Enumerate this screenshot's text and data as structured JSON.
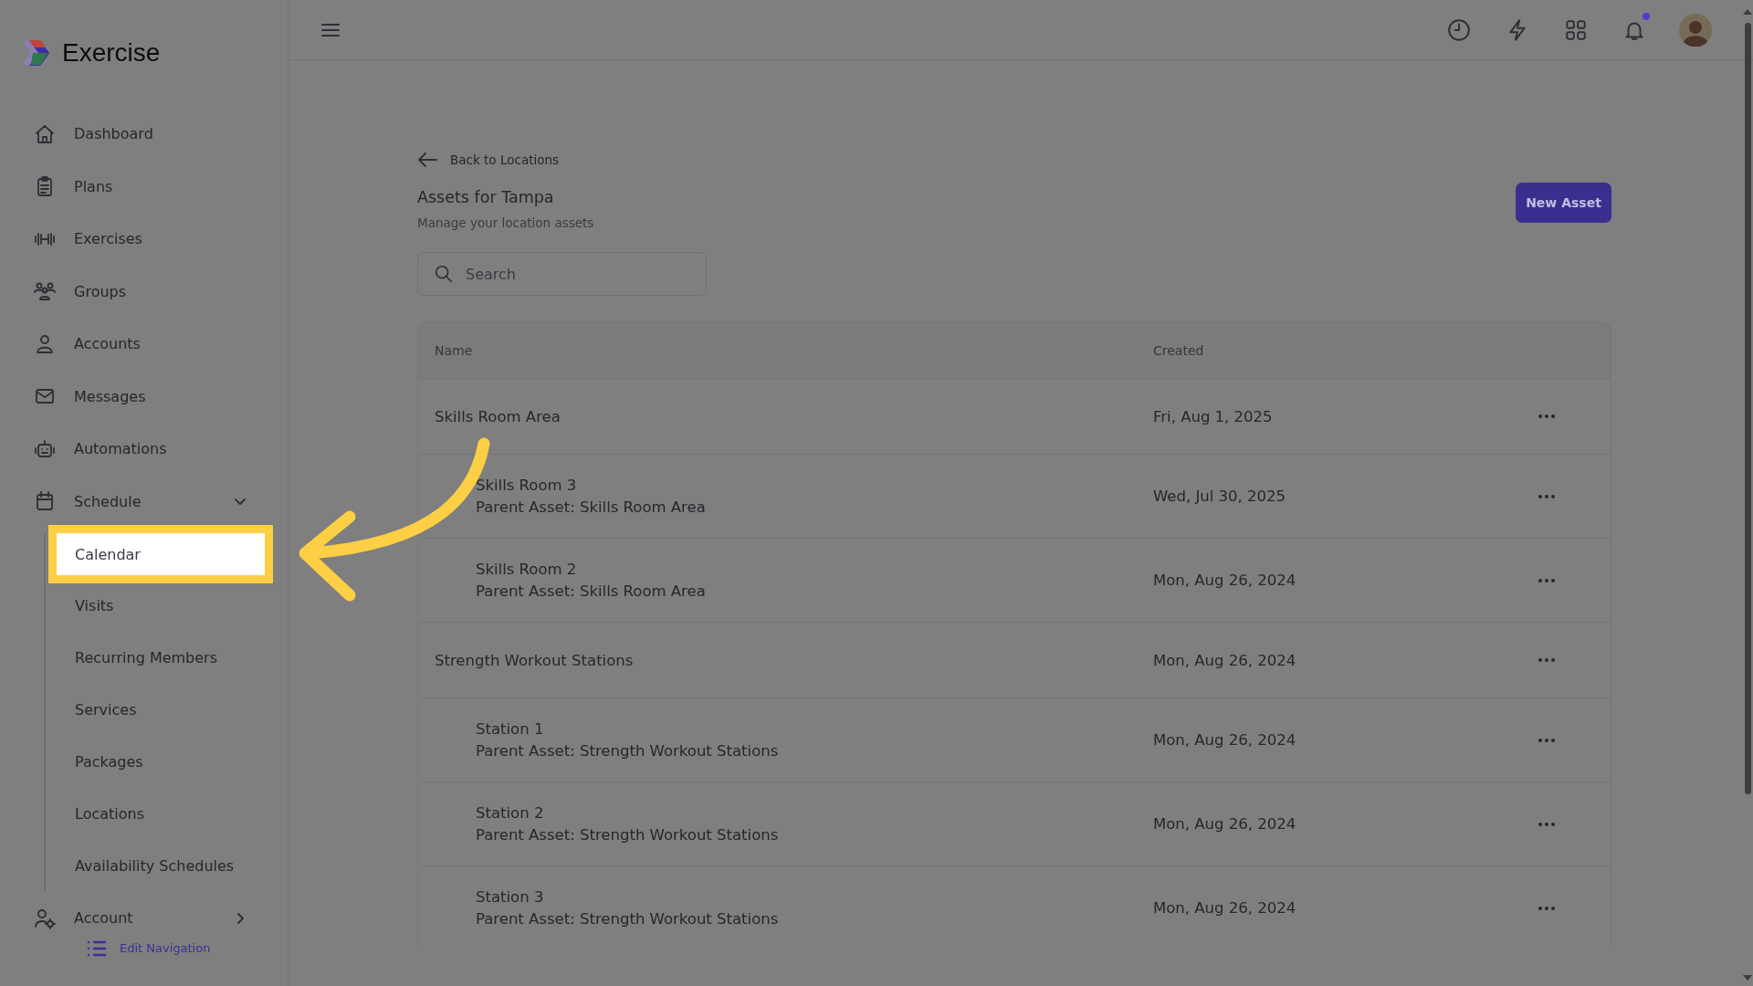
{
  "sidebar": {
    "logo": "Exercise",
    "items": [
      {
        "label": "Dashboard"
      },
      {
        "label": "Plans"
      },
      {
        "label": "Exercises"
      },
      {
        "label": "Groups"
      },
      {
        "label": "Accounts"
      },
      {
        "label": "Messages"
      },
      {
        "label": "Automations"
      },
      {
        "label": "Schedule",
        "expanded": true,
        "children": [
          {
            "label": "Calendar",
            "selected": true
          },
          {
            "label": "Visits",
            "selected": false
          },
          {
            "label": "Recurring Members",
            "selected": false
          },
          {
            "label": "Services",
            "selected": false
          },
          {
            "label": "Packages",
            "selected": false
          },
          {
            "label": "Locations",
            "selected": false
          },
          {
            "label": "Availability Schedules",
            "selected": false
          }
        ]
      },
      {
        "label": "Account",
        "expanded": false
      }
    ],
    "edit_link": "Edit Navigation"
  },
  "topbar": {
    "notifications_unread": true
  },
  "page": {
    "back_link": "Back to Locations",
    "title": "Assets for Tampa",
    "subtitle": "Manage your location assets",
    "new_button": "New Asset",
    "search": {
      "placeholder": "Search"
    },
    "table": {
      "columns": [
        "Name",
        "Created"
      ],
      "rows": [
        {
          "name": "Skills Room Area",
          "created": "Fri, Aug 1, 2025",
          "children": [
            {
              "name": "Skills Room 3",
              "parent": "Parent Asset: Skills Room Area",
              "created": "Wed, Jul 30, 2025"
            },
            {
              "name": "Skills Room 2",
              "parent": "Parent Asset: Skills Room Area",
              "created": "Mon, Aug 26, 2024"
            }
          ]
        },
        {
          "name": "Strength Workout Stations",
          "created": "Mon, Aug 26, 2024",
          "children": [
            {
              "name": "Station 1",
              "parent": "Parent Asset: Strength Workout Stations",
              "created": "Mon, Aug 26, 2024"
            },
            {
              "name": "Station 2",
              "parent": "Parent Asset: Strength Workout Stations",
              "created": "Mon, Aug 26, 2024"
            },
            {
              "name": "Station 3",
              "parent": "Parent Asset: Strength Workout Stations",
              "created": "Mon, Aug 26, 2024"
            }
          ]
        }
      ]
    }
  }
}
